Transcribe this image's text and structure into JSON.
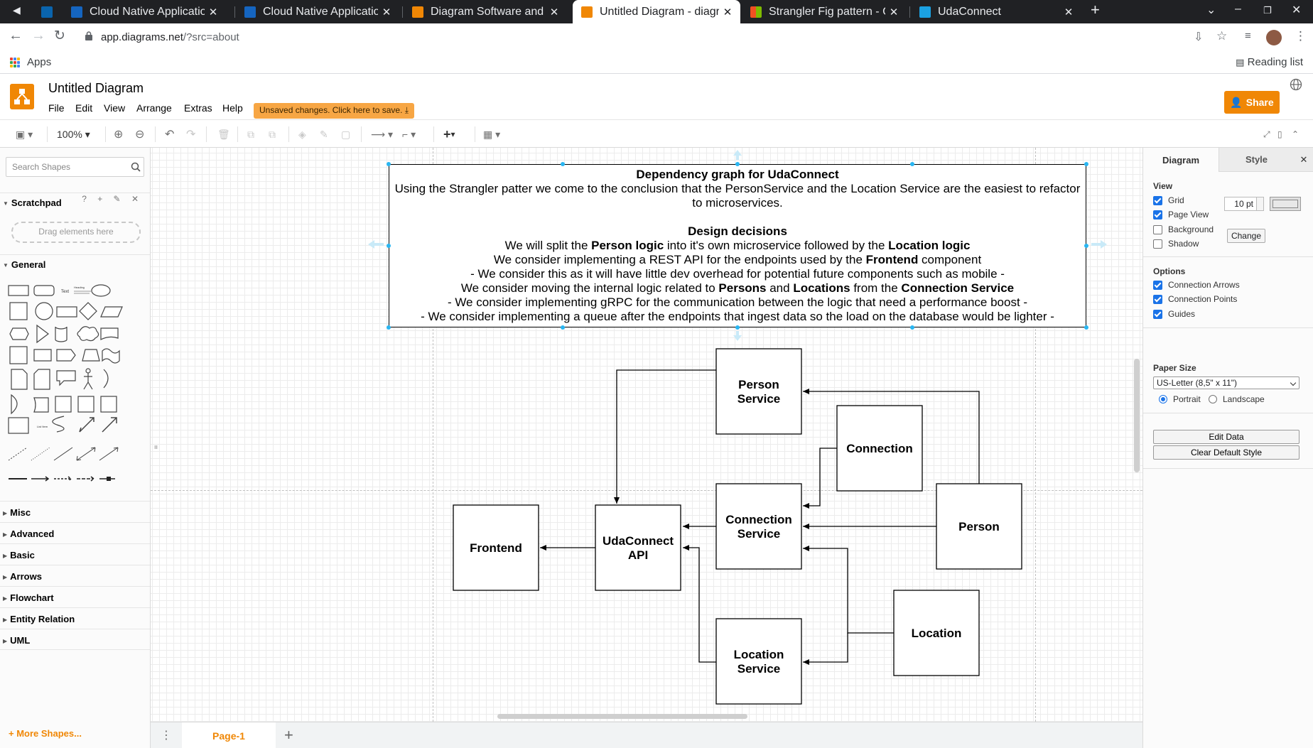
{
  "browser": {
    "tabs": [
      {
        "title": "Cloud Native Application",
        "favicon_color": "#1565c0"
      },
      {
        "title": "Cloud Native Application",
        "favicon_color": "#1565c0"
      },
      {
        "title": "Diagram Software and Flo",
        "favicon_color": "#f08705"
      },
      {
        "title": "Untitled Diagram - diagra",
        "favicon_color": "#f08705",
        "active": true
      },
      {
        "title": "Strangler Fig pattern - Clo",
        "favicon_color": "#f25022"
      },
      {
        "title": "UdaConnect",
        "favicon_color": "#1ba1e2"
      }
    ],
    "url_host": "app.diagrams.net",
    "url_path": "/?src=about",
    "bookmarks_apps": "Apps",
    "reading_list": "Reading list"
  },
  "app": {
    "title": "Untitled Diagram",
    "menu": [
      "File",
      "Edit",
      "View",
      "Arrange",
      "Extras",
      "Help"
    ],
    "unsaved": "Unsaved changes. Click here to save.",
    "share": "Share",
    "zoom": "100%",
    "brand_color": "#f08705"
  },
  "sidebar": {
    "search_placeholder": "Search Shapes",
    "scratchpad": "Scratchpad",
    "scratch_drop": "Drag elements here",
    "general": "General",
    "sections": [
      "Misc",
      "Advanced",
      "Basic",
      "Arrows",
      "Flowchart",
      "Entity Relation",
      "UML"
    ],
    "more_shapes": "More Shapes..."
  },
  "textbox": {
    "title": "Dependency graph for UdaConnect",
    "intro": "Using the Strangler patter we come to the conclusion that the PersonService and the Location Service are the easiest to refactor to microservices.",
    "design_title": "Design decisions",
    "l1_a": "We will split the ",
    "l1_b": "Person logic",
    "l1_c": " into it's own microservice followed by the ",
    "l1_d": "Location logic",
    "l2_a": "We consider implementing a REST API for the endpoints used by the ",
    "l2_b": "Frontend",
    "l2_c": " component",
    "l3": "- We consider this as it will have little dev overhead for potential future components such as mobile -",
    "l4_a": "We consider moving the internal logic related to ",
    "l4_b": "Persons",
    "l4_c": " and ",
    "l4_d": "Locations",
    "l4_e": " from the ",
    "l4_f": "Connection Service",
    "l5": "- We consider implementing gRPC for the communication between the logic that need a performance boost -",
    "l6": "- We consider implementing a queue after the endpoints that ingest data so the load on the database would be lighter -"
  },
  "nodes": {
    "person_service": [
      "Person",
      "Service"
    ],
    "connection": [
      "Connection"
    ],
    "connection_service": [
      "Connection",
      "Service"
    ],
    "person": [
      "Person"
    ],
    "frontend": [
      "Frontend"
    ],
    "udaconnect_api": [
      "UdaConnect",
      "API"
    ],
    "location": [
      "Location"
    ],
    "location_service": [
      "Location",
      "Service"
    ]
  },
  "bottom": {
    "page_tab": "Page-1"
  },
  "format": {
    "tab_diagram": "Diagram",
    "tab_style": "Style",
    "view": "View",
    "grid": "Grid",
    "grid_size": "10 pt",
    "page_view": "Page View",
    "background": "Background",
    "change": "Change",
    "shadow": "Shadow",
    "options": "Options",
    "connection_arrows": "Connection Arrows",
    "connection_points": "Connection Points",
    "guides": "Guides",
    "paper_size": "Paper Size",
    "paper_value": "US-Letter (8,5\" x 11\")",
    "portrait": "Portrait",
    "landscape": "Landscape",
    "edit_data": "Edit Data",
    "clear_default": "Clear Default Style"
  }
}
